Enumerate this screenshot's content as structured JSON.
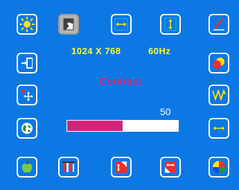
{
  "menu": {
    "items": [
      {
        "name": "brightness-icon",
        "selected": false
      },
      {
        "name": "contrast-icon",
        "selected": true
      },
      {
        "name": "h-position-icon",
        "selected": false
      },
      {
        "name": "v-position-icon",
        "selected": false
      },
      {
        "name": "pen-icon",
        "selected": false
      },
      {
        "name": "exit-icon",
        "selected": false
      },
      {
        "name": "color-icon",
        "selected": false
      },
      {
        "name": "position-move-icon",
        "selected": false
      },
      {
        "name": "wave-icon",
        "selected": false
      },
      {
        "name": "globe-icon",
        "selected": false
      },
      {
        "name": "h-size-icon",
        "selected": false
      },
      {
        "name": "apple-icon",
        "selected": false
      },
      {
        "name": "tools-icon",
        "selected": false
      },
      {
        "name": "v-size-icon",
        "selected": false
      },
      {
        "name": "h-size-expand-icon",
        "selected": false
      },
      {
        "name": "color-wheel-icon",
        "selected": false
      }
    ]
  },
  "display": {
    "resolution": "1024 X 768",
    "refresh": "60Hz"
  },
  "setting": {
    "title": "Contrast",
    "value": "50",
    "level": 0.5
  },
  "colors": {
    "background": "#0c78e4",
    "accent": "#d2257a",
    "info_text": "#ffff2e"
  }
}
